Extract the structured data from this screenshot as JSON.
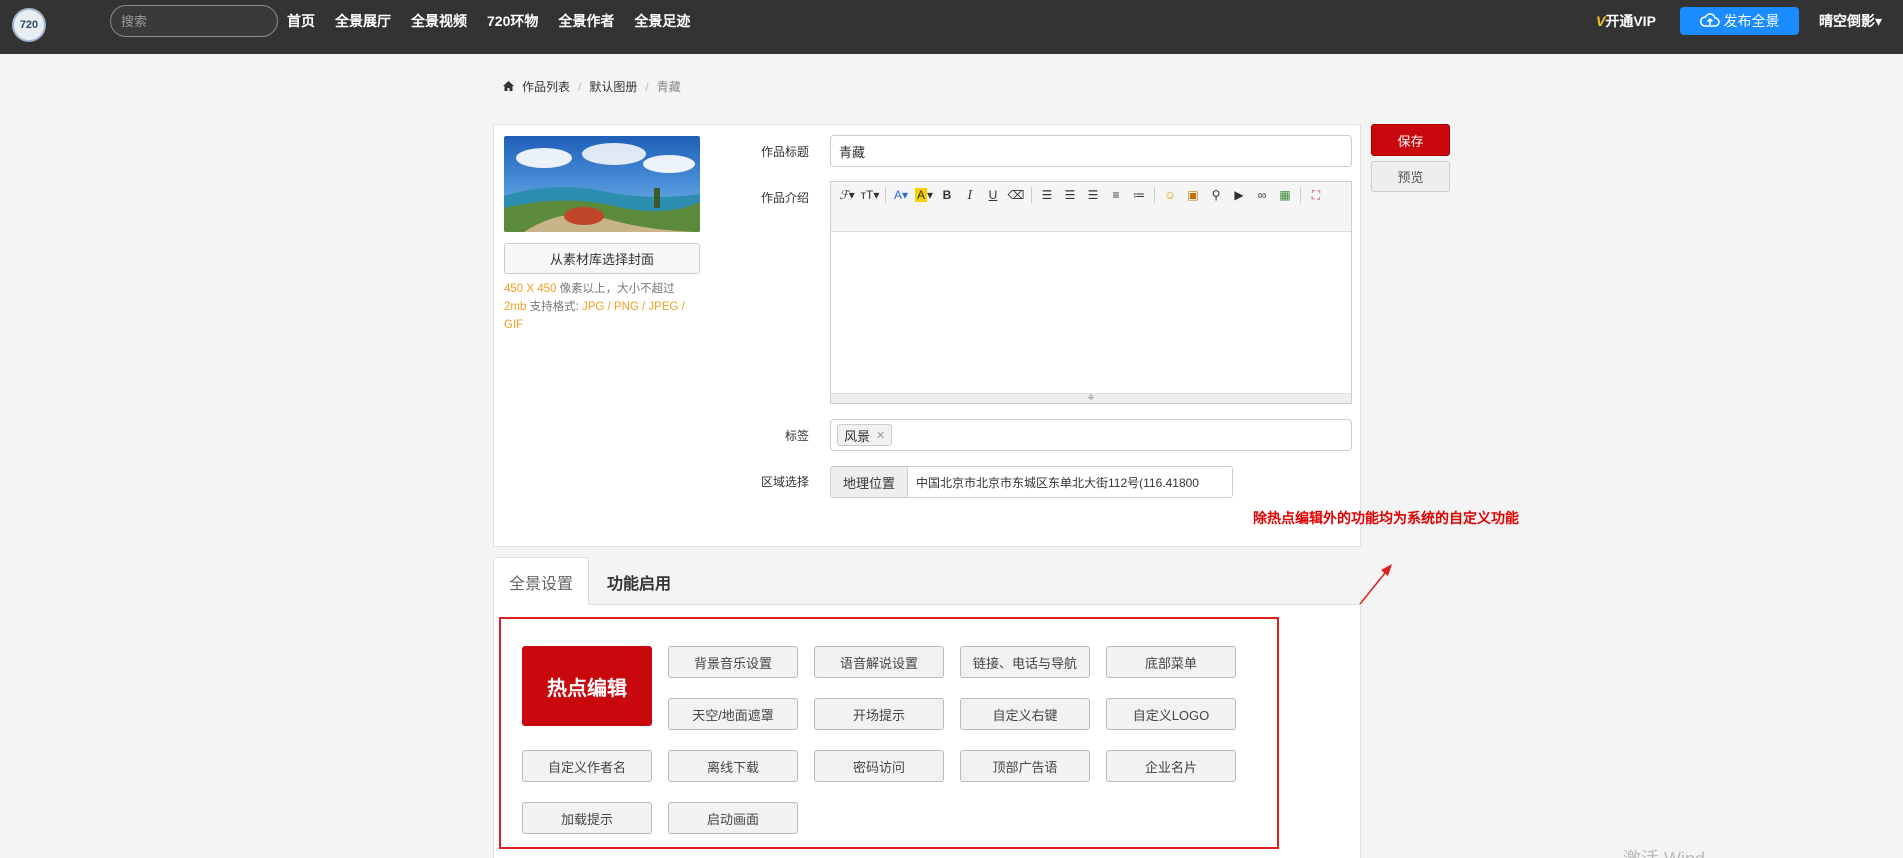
{
  "nav": {
    "logo_text": "720",
    "search_placeholder": "搜索",
    "links": [
      "首页",
      "全景展厅",
      "全景视频",
      "720环物",
      "全景作者",
      "全景足迹"
    ],
    "vip_label": "开通VIP",
    "publish_label": "发布全景",
    "user_label": "晴空倒影"
  },
  "breadcrumb": {
    "items": [
      "作品列表",
      "默认图册"
    ],
    "current": "青藏"
  },
  "form": {
    "title_label": "作品标题",
    "title_value": "青藏",
    "intro_label": "作品介绍",
    "tags_label": "标签",
    "tags": [
      "风景"
    ],
    "region_label": "区域选择",
    "region_addon": "地理位置",
    "region_value": "中国北京市北京市东城区东单北大街112号(116.41800"
  },
  "cover": {
    "select_button": "从素材库选择封面",
    "tip_size": "450 X 450",
    "tip_text1": " 像素以上，大小不超过",
    "tip_mb": "2mb",
    "tip_text2": " 支持格式: ",
    "tip_formats": "JPG / PNG / JPEG / GIF"
  },
  "actions": {
    "save": "保存",
    "preview": "预览"
  },
  "annotation": "除热点编辑外的功能均为系统的自定义功能",
  "tabs": [
    "全景设置",
    "功能启用"
  ],
  "features": {
    "hotspot": "热点编辑",
    "buttons": [
      "背景音乐设置",
      "语音解说设置",
      "链接、电话与导航",
      "底部菜单",
      "天空/地面遮罩",
      "开场提示",
      "自定义右键",
      "自定义LOGO",
      "自定义作者名",
      "离线下载",
      "密码访问",
      "顶部广告语",
      "企业名片",
      "加载提示",
      "启动画面"
    ]
  },
  "colors": {
    "nav_bg": "#333333",
    "accent_red": "#c9080d",
    "publish_blue": "#1a8cff",
    "annotation_red": "#e00000"
  },
  "watermark": "激活 Wind"
}
